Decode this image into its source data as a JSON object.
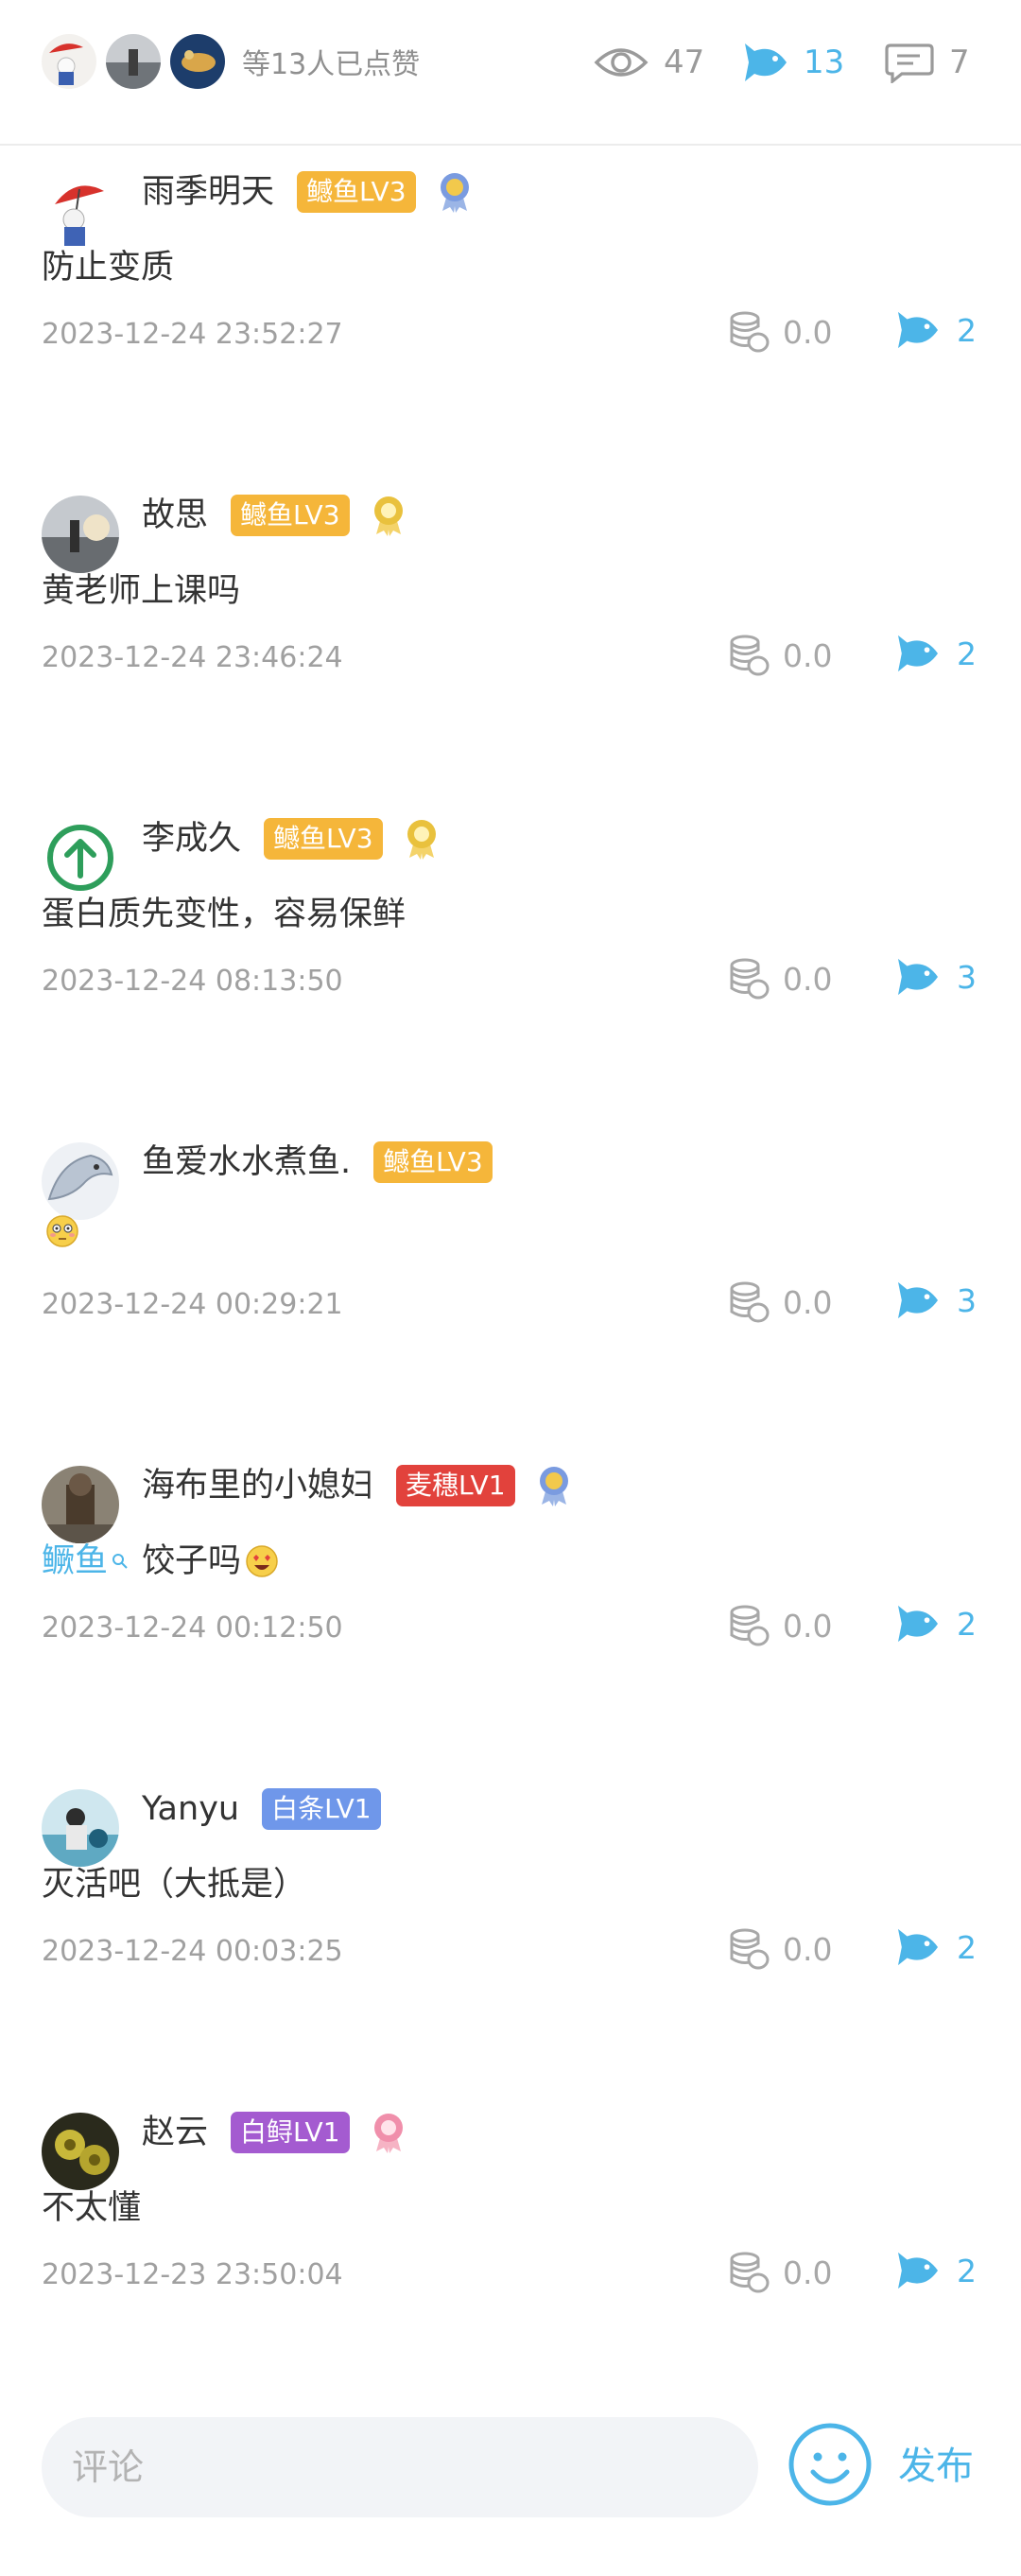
{
  "stats": {
    "liked_text": "等13人已点赞",
    "views": "47",
    "fish": "13",
    "comments": "7"
  },
  "icons": {
    "view": "eye-icon",
    "fish": "fish-icon",
    "comment": "speech-bubble-icon",
    "coin": "coin-stack-icon",
    "emoji": "smiley-icon",
    "search": "search-icon"
  },
  "colors": {
    "accent": "#4cb5e8",
    "badge_orange": "#f5b63a",
    "badge_red": "#e2423c",
    "badge_blue": "#6f97ea",
    "badge_purple": "#a45bd0"
  },
  "comments": [
    {
      "name": "雨季明天",
      "badge": "鳡鱼LV3",
      "badge_color": "#f5b63a",
      "medal": "blue",
      "text": "防止变质",
      "time": "2023-12-24 23:52:27",
      "coins": "0.0",
      "fish": "2"
    },
    {
      "name": "故思",
      "badge": "鳡鱼LV3",
      "badge_color": "#f5b63a",
      "medal": "gold",
      "text": "黄老师上课吗",
      "time": "2023-12-24 23:46:24",
      "coins": "0.0",
      "fish": "2"
    },
    {
      "name": "李成久",
      "badge": "鳡鱼LV3",
      "badge_color": "#f5b63a",
      "medal": "gold",
      "text": "蛋白质先变性，容易保鲜",
      "time": "2023-12-24 08:13:50",
      "coins": "0.0",
      "fish": "3"
    },
    {
      "name": "鱼爱水水煮鱼.",
      "badge": "鳡鱼LV3",
      "badge_color": "#f5b63a",
      "medal": "",
      "text": "",
      "time": "2023-12-24 00:29:21",
      "coins": "0.0",
      "fish": "3"
    },
    {
      "name": "海布里的小媳妇",
      "badge": "麦穗LV1",
      "badge_color": "#e2423c",
      "medal": "blue",
      "mention": "鳜鱼",
      "text": "饺子吗",
      "time": "2023-12-24 00:12:50",
      "coins": "0.0",
      "fish": "2"
    },
    {
      "name": "Yanyu",
      "badge": "白条LV1",
      "badge_color": "#6f97ea",
      "medal": "",
      "text": "灭活吧（大抵是）",
      "time": "2023-12-24 00:03:25",
      "coins": "0.0",
      "fish": "2"
    },
    {
      "name": "赵云",
      "badge": "白鲟LV1",
      "badge_color": "#a45bd0",
      "medal": "pink",
      "text": "不太懂",
      "time": "2023-12-23 23:50:04",
      "coins": "0.0",
      "fish": "2"
    }
  ],
  "bottom": {
    "placeholder": "评论",
    "publish": "发布"
  }
}
